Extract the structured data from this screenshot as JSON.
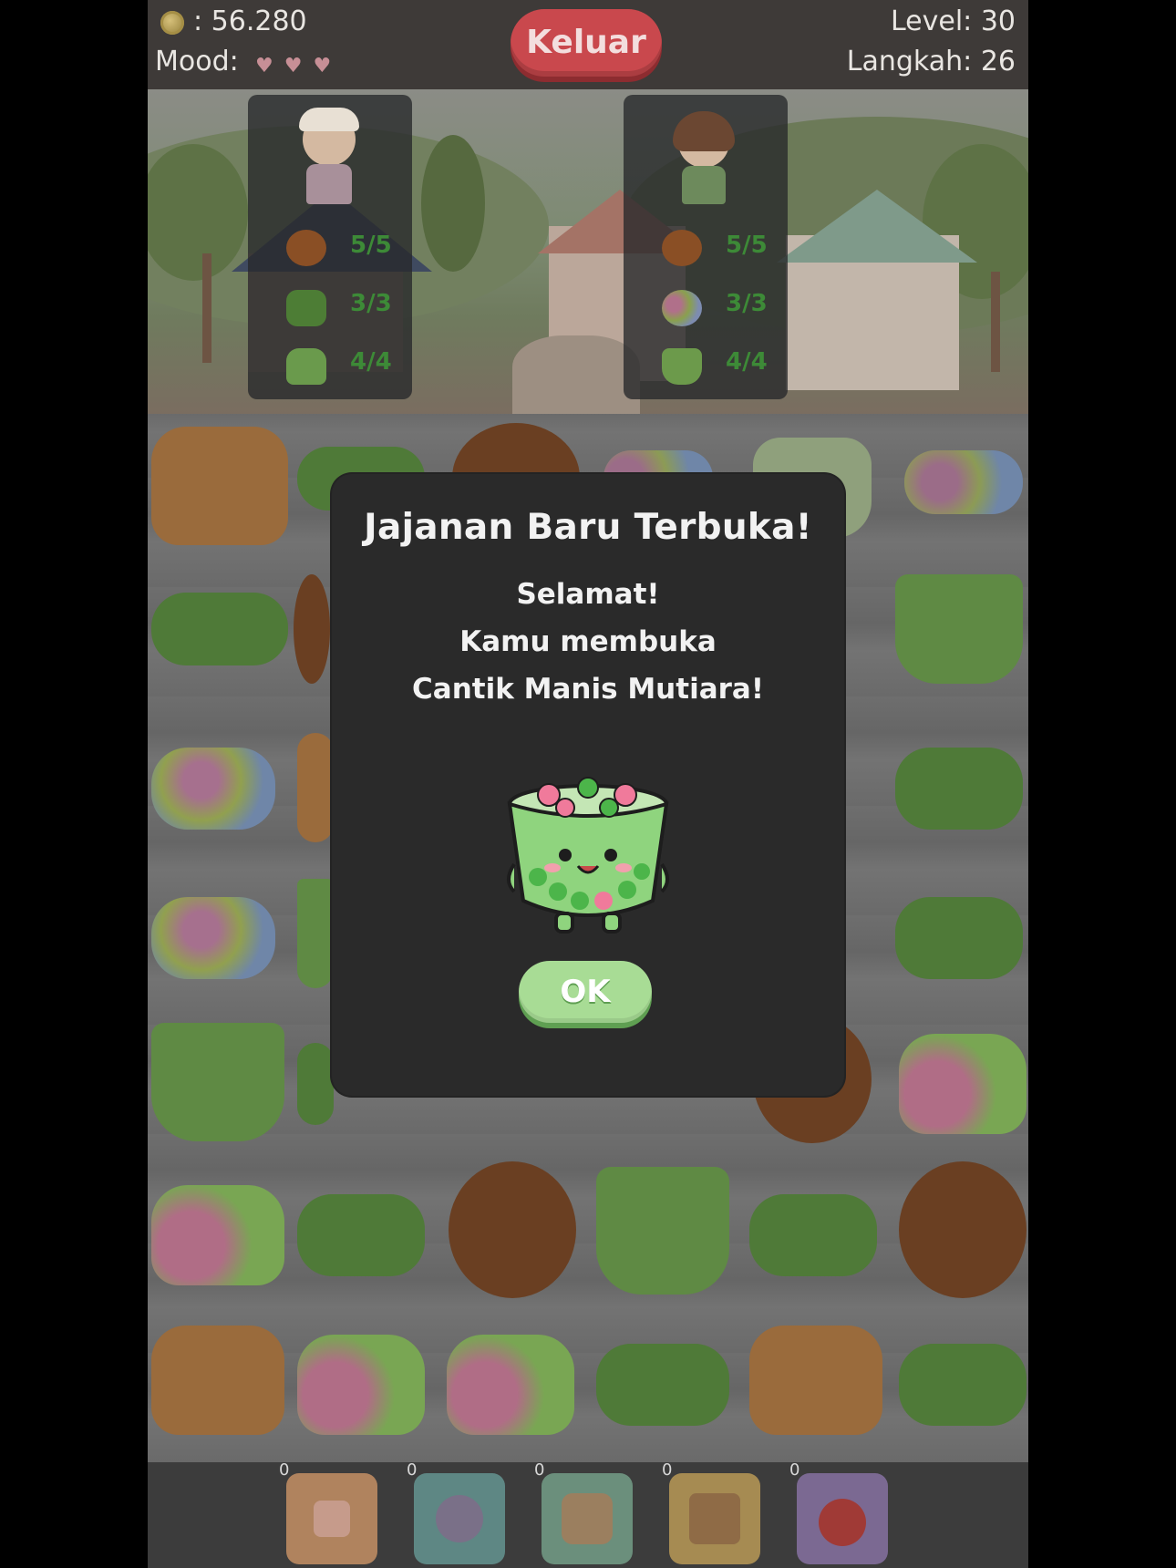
{
  "hud": {
    "coins": ": 56.280",
    "mood_label": "Mood:",
    "exit_button": "Keluar",
    "level": "Level: 30",
    "steps": "Langkah: 26",
    "mood_hearts": 3
  },
  "orders": [
    {
      "character": "grandfather",
      "items": [
        {
          "icon": "onde-onde-icon",
          "count": "5/5"
        },
        {
          "icon": "dadar-gulung-icon",
          "count": "3/3"
        },
        {
          "icon": "putu-ayu-icon",
          "count": "4/4"
        }
      ]
    },
    {
      "character": "girl",
      "items": [
        {
          "icon": "onde-onde-icon",
          "count": "5/5"
        },
        {
          "icon": "cenil-skewer-icon",
          "count": "3/3"
        },
        {
          "icon": "pandan-cup-icon",
          "count": "4/4"
        }
      ]
    }
  ],
  "modal": {
    "title": "Jajanan Baru Terbuka!",
    "line1": "Selamat!",
    "line2": "Kamu membuka",
    "line3": "Cantik Manis Mutiara!",
    "reward_icon": "cantik-manis-mutiara-icon",
    "ok_button": "OK"
  },
  "boosters": [
    {
      "icon": "hand-pick-icon",
      "count": "0"
    },
    {
      "icon": "spoon-icon",
      "count": "0"
    },
    {
      "icon": "triple-swipe-icon",
      "count": "0"
    },
    {
      "icon": "shuffle-cakes-icon",
      "count": "0"
    },
    {
      "icon": "bomb-icon",
      "count": "0"
    }
  ],
  "colors": {
    "exit_button": "#c9484d",
    "ok_button": "#a8dc95",
    "order_count": "#3d8a37",
    "modal_bg": "#2a2a2a"
  }
}
